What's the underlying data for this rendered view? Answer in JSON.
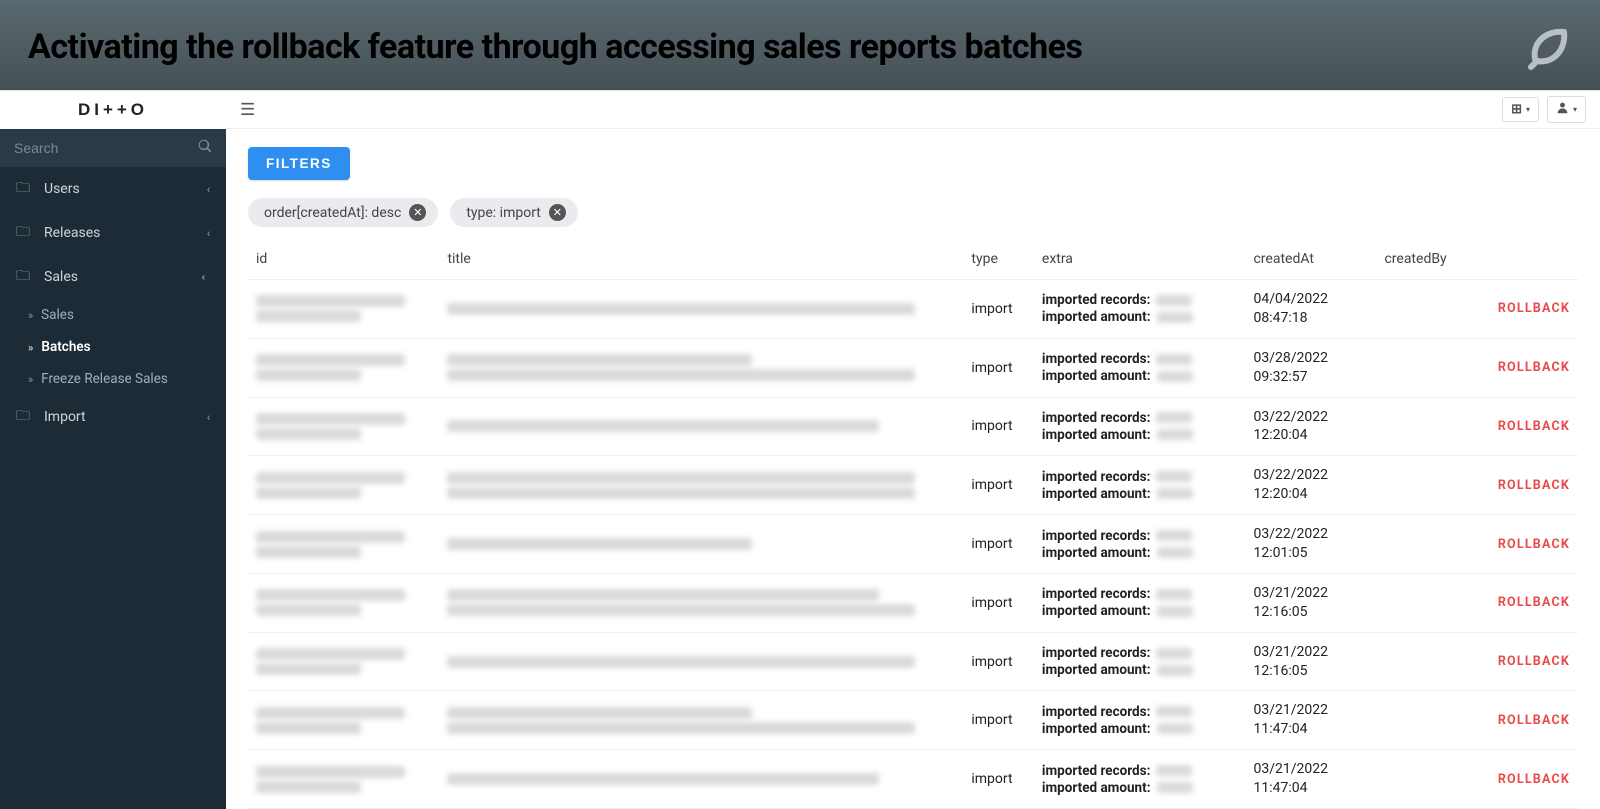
{
  "banner": {
    "title": "Activating the rollback feature through accessing sales reports batches"
  },
  "brand": "DI++O",
  "search": {
    "placeholder": "Search"
  },
  "nav": {
    "users": "Users",
    "releases": "Releases",
    "sales": "Sales",
    "sales_sub": {
      "sales": "Sales",
      "batches": "Batches",
      "freeze": "Freeze Release Sales"
    },
    "import": "Import"
  },
  "filters_label": "FILTERS",
  "chips": [
    {
      "text": "order[createdAt]: desc"
    },
    {
      "text": "type: import"
    }
  ],
  "columns": {
    "id": "id",
    "title": "title",
    "type": "type",
    "extra": "extra",
    "createdAt": "createdAt",
    "createdBy": "createdBy"
  },
  "extra_labels": {
    "records": "imported records:",
    "amount": "imported amount:"
  },
  "rollback_label": "ROLLBACK",
  "rows": [
    {
      "type": "import",
      "date": "04/04/2022",
      "time": "08:47:18"
    },
    {
      "type": "import",
      "date": "03/28/2022",
      "time": "09:32:57"
    },
    {
      "type": "import",
      "date": "03/22/2022",
      "time": "12:20:04"
    },
    {
      "type": "import",
      "date": "03/22/2022",
      "time": "12:20:04"
    },
    {
      "type": "import",
      "date": "03/22/2022",
      "time": "12:01:05"
    },
    {
      "type": "import",
      "date": "03/21/2022",
      "time": "12:16:05"
    },
    {
      "type": "import",
      "date": "03/21/2022",
      "time": "12:16:05"
    },
    {
      "type": "import",
      "date": "03/21/2022",
      "time": "11:47:04"
    },
    {
      "type": "import",
      "date": "03/21/2022",
      "time": "11:47:04"
    }
  ]
}
